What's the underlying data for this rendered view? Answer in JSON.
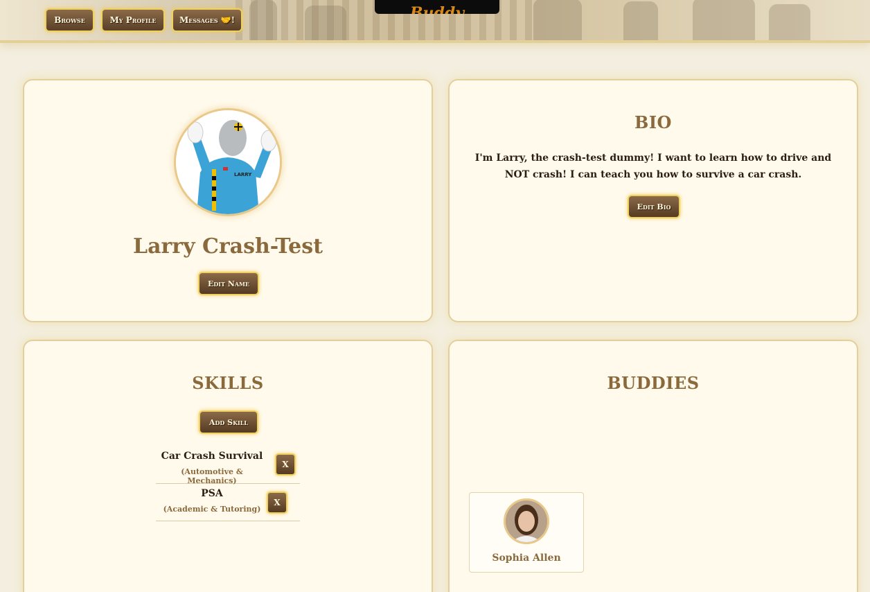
{
  "nav": {
    "browse": "Browse",
    "my_profile": "My Profile",
    "messages": "Messages 🤝!"
  },
  "logo": {
    "text": "Buddy"
  },
  "profile": {
    "name": "Larry Crash-Test",
    "edit_name_label": "Edit Name"
  },
  "bio": {
    "title": "BIO",
    "text": "I'm Larry, the crash-test dummy! I want to learn how to drive and NOT crash! I can teach you how to survive a car crash.",
    "edit_label": "Edit Bio"
  },
  "skills": {
    "title": "SKILLS",
    "add_label": "Add Skill",
    "items": [
      {
        "name": "Car Crash Survival",
        "category": "(Automotive & Mechanics)",
        "remove": "X"
      },
      {
        "name": "PSA",
        "category": "(Academic & Tutoring)",
        "remove": "X"
      }
    ]
  },
  "buddies": {
    "title": "BUDDIES",
    "items": [
      {
        "name": "Sophia Allen"
      }
    ]
  },
  "colors": {
    "accent_gold": "#f0d060",
    "button_brown": "#6e5034",
    "title_brown": "#8a6a3c",
    "card_bg": "#fffaec",
    "page_bg": "#f3eedf"
  }
}
